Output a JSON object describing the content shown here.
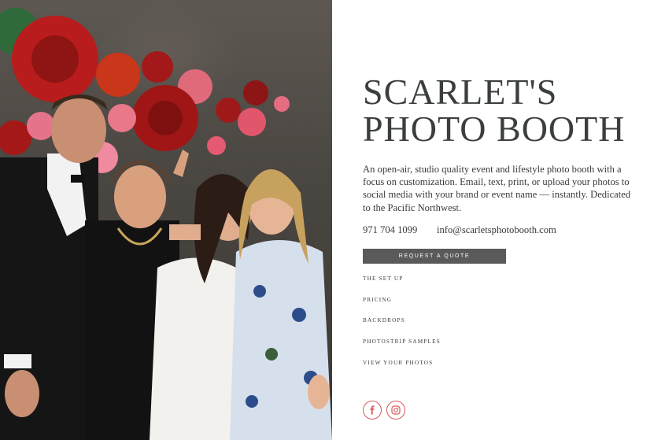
{
  "hero": {
    "title_line1": "SCARLET'S",
    "title_line2": "PHOTO BOOTH",
    "description": "An open-air, studio quality event and lifestyle photo booth with a focus on customization. Email, text, print, or upload your photos to social media with your brand or event name — instantly. Dedicated to the Pacific Northwest.",
    "phone": "971 704 1099",
    "email": "info@scarletsphotobooth.com",
    "cta_label": "REQUEST A QUOTE"
  },
  "nav": {
    "items": [
      {
        "label": "THE SET UP"
      },
      {
        "label": "PRICING"
      },
      {
        "label": "BACKDROPS"
      },
      {
        "label": "PHOTOSTRIP SAMPLES"
      },
      {
        "label": "VIEW YOUR PHOTOS"
      }
    ]
  },
  "social": {
    "icons": [
      "facebook-icon",
      "instagram-icon"
    ]
  },
  "colors": {
    "accent": "#d85a5a",
    "button_bg": "#5a5a5a",
    "title": "#3a3f3d"
  }
}
